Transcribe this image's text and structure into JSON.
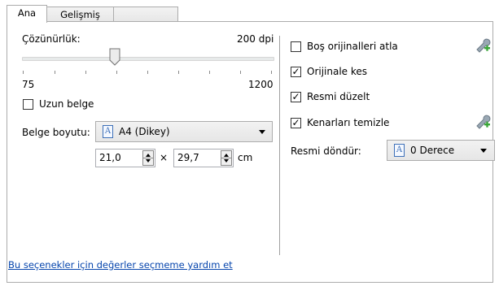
{
  "tabs": [
    {
      "label": "Ana",
      "active": true
    },
    {
      "label": "Gelişmiş",
      "active": false
    },
    {
      "label": "",
      "active": false
    }
  ],
  "resolution": {
    "label": "Çözünürlük:",
    "value_text": "200 dpi",
    "min_label": "75",
    "max_label": "1200",
    "value": 200,
    "min": 75,
    "max": 1200
  },
  "long_document": {
    "label": "Uzun belge",
    "checked": false
  },
  "document_size": {
    "label": "Belge boyutu:",
    "selected": "A4 (Dikey)",
    "icon": "document-icon",
    "width": "21,0",
    "times": "×",
    "height": "29,7",
    "unit": "cm"
  },
  "options": [
    {
      "label": "Boş orijinalleri atla",
      "checked": false,
      "has_settings": true
    },
    {
      "label": "Orijinale kes",
      "checked": true,
      "has_settings": false
    },
    {
      "label": "Resmi düzelt",
      "checked": true,
      "has_settings": false
    },
    {
      "label": "Kenarları temizle",
      "checked": true,
      "has_settings": true
    }
  ],
  "rotate": {
    "label": "Resmi döndür:",
    "selected": "0 Derece",
    "icon": "document-icon"
  },
  "help_link": "Bu seçenekler için değerler seçmeme yardım et",
  "colors": {
    "link": "#0645ad",
    "icon_blue": "#3c6fb8",
    "wrench": "#8a9aa8",
    "plus_green": "#3aa639"
  }
}
